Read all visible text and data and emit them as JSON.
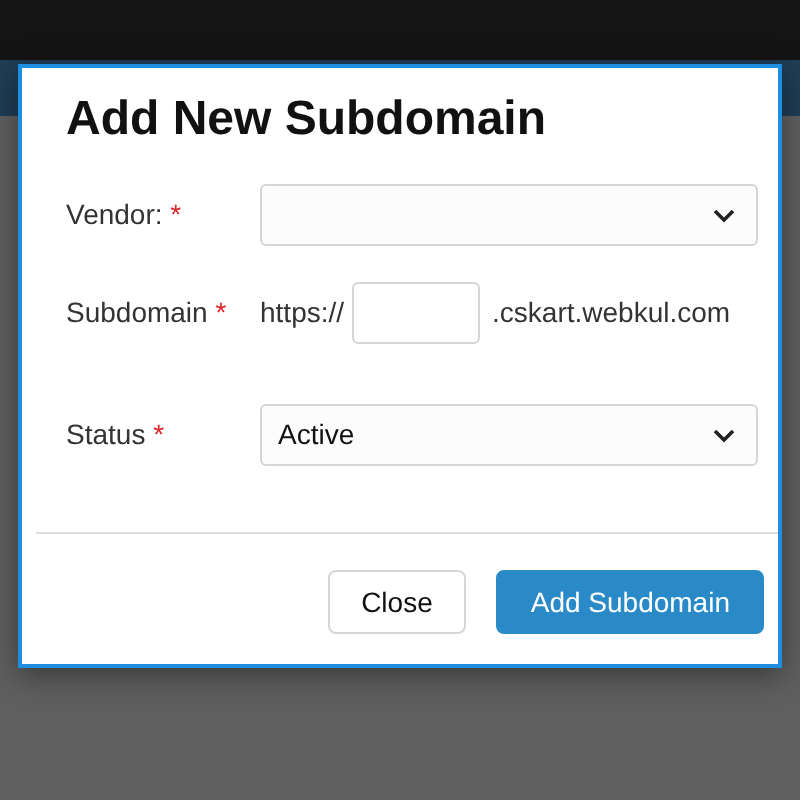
{
  "dialog": {
    "title": "Add New Subdomain",
    "fields": [
      {
        "kind": "select",
        "label": "Vendor:",
        "required_mark": "*"
      },
      {
        "kind": "subdomain",
        "label": "Subdomain",
        "required_mark": "*",
        "prefix": "https://",
        "suffix": ".cskart.webkul.com"
      },
      {
        "kind": "select",
        "label": "Status",
        "required_mark": "*",
        "value": "Active"
      }
    ],
    "buttons": [
      {
        "label": "Close",
        "kind": "secondary"
      },
      {
        "label": "Add Subdomain",
        "kind": "primary"
      }
    ]
  }
}
